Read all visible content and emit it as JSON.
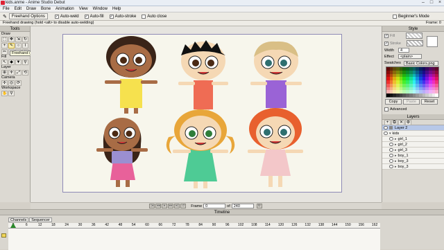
{
  "window": {
    "title": "kids.anme - Anime Studio Debut"
  },
  "menu": [
    "File",
    "Edit",
    "Draw",
    "Bone",
    "Animation",
    "View",
    "Window",
    "Help"
  ],
  "options": {
    "tool_button": "Freehand Options",
    "auto_weld": "Auto-weld",
    "auto_fill": "Auto-fill",
    "auto_stroke": "Auto-stroke",
    "auto_close": "Auto close",
    "beginners_mode": "Beginner's Mode"
  },
  "status": {
    "message": "Freehand drawing (hold <alt> to disable auto-welding)",
    "frame": "Frame: 0"
  },
  "tools": {
    "header": "Tools",
    "sections": {
      "draw": "Draw",
      "fill": "Fill",
      "layer": "Layer",
      "camera": "Camera",
      "workspace": "Workspace"
    },
    "tooltip": "Freehand (F)"
  },
  "style": {
    "header": "Style",
    "fill": "Fill",
    "stroke": "Stroke",
    "width_label": "Width",
    "width_value": "4",
    "effect_label": "Effect",
    "effect_value": "<plain>",
    "swatches_label": "Swatches",
    "swatches_value": "Basic Colors.png",
    "copy": "Copy",
    "paste": "Paste",
    "reset": "Reset",
    "advanced": "Advanced"
  },
  "layers": {
    "header": "Layers",
    "items": [
      "Layer 2",
      "kids",
      "girl_1",
      "girl_2",
      "girl_3",
      "boy_1",
      "boy_3",
      "boy_3"
    ]
  },
  "nav": {
    "frame_label": "Frame",
    "frame_value": "0",
    "of_label": "of",
    "total": "240"
  },
  "timeline": {
    "header": "Timeline",
    "tabs": [
      "Channels",
      "Sequencer"
    ],
    "ruler": [
      "0",
      "6",
      "12",
      "18",
      "24",
      "30",
      "36",
      "42",
      "48",
      "54",
      "60",
      "66",
      "72",
      "78",
      "84",
      "90",
      "96",
      "102",
      "108",
      "114",
      "120",
      "126",
      "132",
      "138",
      "144",
      "150",
      "156",
      "162"
    ]
  },
  "colors": {
    "stage_border": "#8e8ab6",
    "selected_layer": "#b7c8e8",
    "skin_dark": "#a86c45",
    "skin_mid": "#c98a5a",
    "skin_light": "#f5d8b4"
  }
}
